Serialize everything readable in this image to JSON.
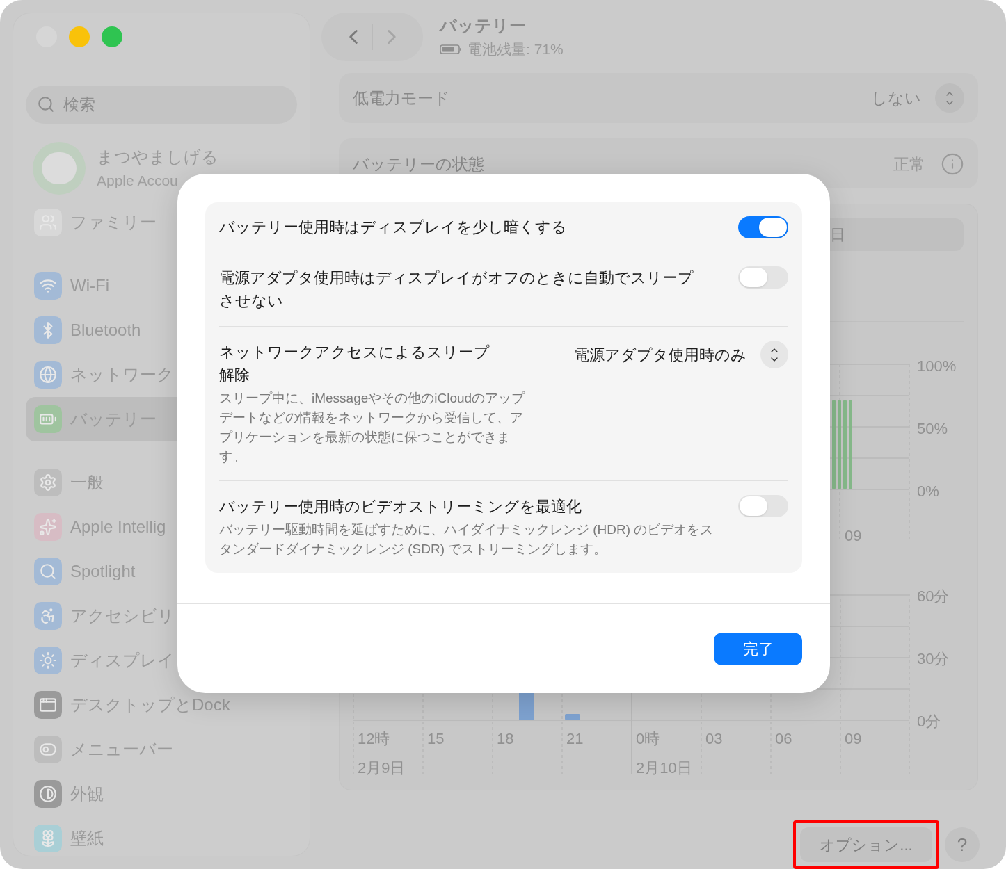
{
  "sidebar": {
    "search": {
      "placeholder": "検索"
    },
    "account": {
      "name": "まつやましげる",
      "subtitle": "Apple Accou"
    },
    "groups": [
      {
        "items": [
          {
            "label": "ファミリー",
            "selected": false
          }
        ]
      },
      {
        "items": [
          {
            "label": "Wi-Fi",
            "selected": false
          },
          {
            "label": "Bluetooth",
            "selected": false
          },
          {
            "label": "ネットワーク",
            "selected": false
          },
          {
            "label": "バッテリー",
            "selected": true
          }
        ]
      },
      {
        "items": [
          {
            "label": "一般",
            "selected": false
          },
          {
            "label": "Apple Intellig",
            "selected": false
          },
          {
            "label": "Spotlight",
            "selected": false
          },
          {
            "label": "アクセシビリ",
            "selected": false
          },
          {
            "label": "ディスプレイ",
            "selected": false
          },
          {
            "label": "デスクトップとDock",
            "selected": false
          },
          {
            "label": "メニューバー",
            "selected": false
          },
          {
            "label": "外観",
            "selected": false
          },
          {
            "label": "壁紙",
            "selected": false
          }
        ]
      }
    ]
  },
  "header": {
    "title": "バッテリー",
    "subtitle": "電池残量: 71%"
  },
  "low_power_mode": {
    "label": "低電力モード",
    "value": "しない"
  },
  "battery_health": {
    "label": "バッテリーの状態",
    "value": "正常"
  },
  "range_control": {
    "segment_label": "日"
  },
  "battery_level_chart": {
    "y_labels": [
      "100%",
      "50%",
      "0%"
    ],
    "x_labels": [
      "09"
    ]
  },
  "usage_chart": {
    "y_labels": [
      "60分",
      "30分",
      "0分"
    ],
    "x_labels": [
      "12時",
      "15",
      "18",
      "21",
      "0時",
      "03",
      "06",
      "09"
    ],
    "date_labels": [
      "2月9日",
      "2月10日"
    ]
  },
  "footer": {
    "options_button": "オプション...",
    "highlighted": true,
    "help_button": "?"
  },
  "sheet": {
    "rows": [
      {
        "kind": "toggle",
        "label": "バッテリー使用時はディスプレイを少し暗くする",
        "on": true
      },
      {
        "kind": "toggle",
        "label": "電源アダプタ使用時はディスプレイがオフのときに自動でスリープさせない",
        "on": false
      },
      {
        "kind": "select",
        "label": "ネットワークアクセスによるスリープ解除",
        "value": "電源アダプタ使用時のみ",
        "description": "スリープ中に、iMessageやその他のiCloudのアップデートなどの情報をネットワークから受信して、アプリケーションを最新の状態に保つことができます。"
      },
      {
        "kind": "toggle",
        "label": "バッテリー使用時のビデオストリーミングを最適化",
        "description": "バッテリー駆動時間を延ばすために、ハイダイナミックレンジ (HDR) のビデオをスタンダードダイナミックレンジ (SDR) でストリーミングします。",
        "on": false
      }
    ],
    "done_button": "完了"
  }
}
